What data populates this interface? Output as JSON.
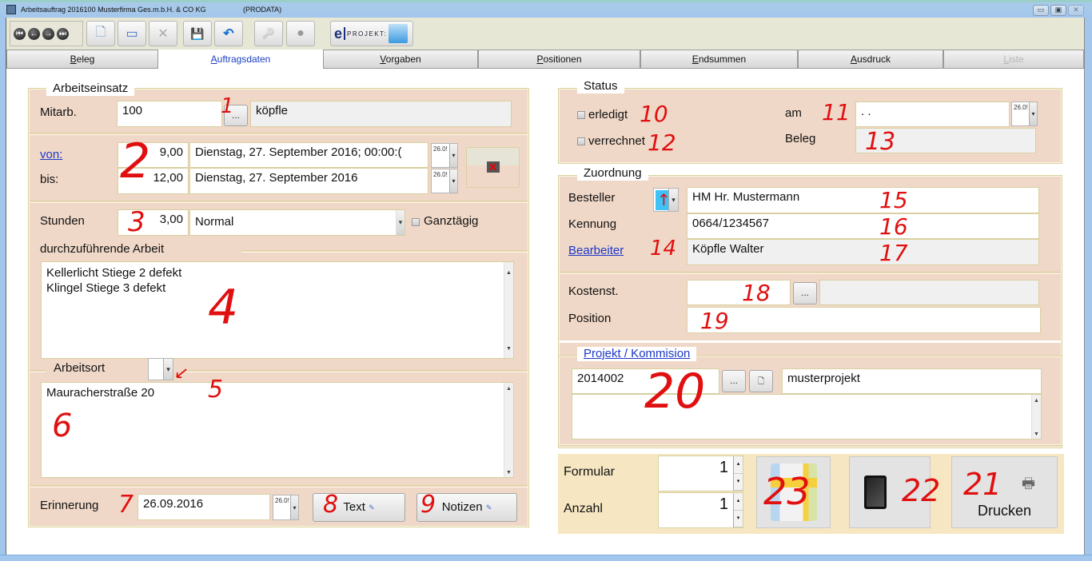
{
  "window": {
    "title": "Arbeitsauftrag  2016100  Musterfirma Ges.m.b.H. & CO KG",
    "subtitle": "(PRODATA)",
    "controls": {
      "minimize": "▭",
      "maximize": "▣",
      "close": "✕"
    }
  },
  "toolbar": {
    "nav": [
      "first-record-icon",
      "previous-record-icon",
      "next-record-icon",
      "last-record-icon"
    ],
    "buttons": [
      {
        "name": "new-document-icon",
        "glyph": "🗋"
      },
      {
        "name": "edit-window-icon",
        "glyph": "▭"
      },
      {
        "name": "delete-icon",
        "glyph": "✕"
      },
      {
        "name": "save-icon",
        "glyph": "💾"
      },
      {
        "name": "undo-icon",
        "glyph": "↶"
      },
      {
        "name": "key-icon",
        "glyph": "🔑"
      },
      {
        "name": "apple-icon",
        "glyph": "●"
      }
    ],
    "eprojekt_label": "PROJEKT:",
    "eprojekt_e": "e"
  },
  "tabs": [
    {
      "label": "Beleg",
      "state": "normal"
    },
    {
      "label": "Auftragsdaten",
      "state": "active"
    },
    {
      "label": "Vorgaben",
      "state": "normal"
    },
    {
      "label": "Positionen",
      "state": "normal"
    },
    {
      "label": "Endsummen",
      "state": "normal"
    },
    {
      "label": "Ausdruck",
      "state": "normal"
    },
    {
      "label": "Liste",
      "state": "disabled"
    }
  ],
  "arbeitseinsatz": {
    "legend": "Arbeitseinsatz",
    "mitarb_label": "Mitarb.",
    "mitarb_value": "100",
    "mitarb_lookup": "...",
    "mitarb_name": "köpfle",
    "von_label": "von:",
    "von_time": "9,00",
    "von_date": "Dienstag, 27. September 2016; 00:00:(",
    "bis_label": "bis:",
    "bis_time": "12,00",
    "bis_date": "Dienstag, 27. September 2016",
    "date_picker_text": "26.0!",
    "stunden_label": "Stunden",
    "stunden_value": "3,00",
    "stunden_type": "Normal",
    "ganztaegig_label": "Ganztägig",
    "ganztaegig_checked": false,
    "arbeit_label": "durchzuführende Arbeit",
    "arbeit_lines": [
      "Kellerlicht Stiege 2 defekt",
      "Klingel Stiege 3 defekt"
    ],
    "arbeitsort_label": "Arbeitsort",
    "arbeitsort_value": "Mauracherstraße 20",
    "erinnerung_label": "Erinnerung",
    "erinnerung_value": "26.09.2016",
    "text_button": "Text",
    "notizen_button": "Notizen"
  },
  "status": {
    "legend": "Status",
    "erledigt_label": "erledigt",
    "erledigt_checked": false,
    "verrechnet_label": "verrechnet",
    "verrechnet_checked": false,
    "am_label": "am",
    "am_value": " .  .",
    "beleg_label": "Beleg",
    "beleg_value": "",
    "date_picker_text": "26.0!"
  },
  "zuordnung": {
    "legend": "Zuordnung",
    "besteller_label": "Besteller",
    "besteller_color": "#3ec2f7",
    "besteller_value": "HM Hr. Mustermann",
    "kennung_label": "Kennung",
    "kennung_value": "0664/1234567",
    "bearbeiter_label": "Bearbeiter",
    "bearbeiter_value": "Köpfle Walter",
    "kostenst_label": "Kostenst.",
    "kostenst_value": "",
    "kostenst_lookup": "...",
    "kostenst_name": "",
    "position_label": "Position",
    "position_value": ""
  },
  "projekt": {
    "legend": "Projekt / Kommision",
    "number": "2014002",
    "lookup": "...",
    "new_glyph": "🗋",
    "name": "musterprojekt",
    "notes": ""
  },
  "print": {
    "formular_label": "Formular",
    "formular_value": "1",
    "anzahl_label": "Anzahl",
    "anzahl_value": "1",
    "map_button": "map-icon",
    "tablet_button": "tablet-icon",
    "drucken_label": "Drucken"
  },
  "annotations": [
    "1",
    "2",
    "3",
    "4",
    "5",
    "6",
    "7",
    "8",
    "9",
    "10",
    "11",
    "12",
    "13",
    "14",
    "15",
    "16",
    "17",
    "18",
    "19",
    "20",
    "21",
    "22",
    "23"
  ],
  "colors": {
    "panel_bg": "#f0d8c8",
    "print_panel_bg": "#f6e7c2",
    "link": "#1b37c9",
    "annotation": "#e01010"
  }
}
